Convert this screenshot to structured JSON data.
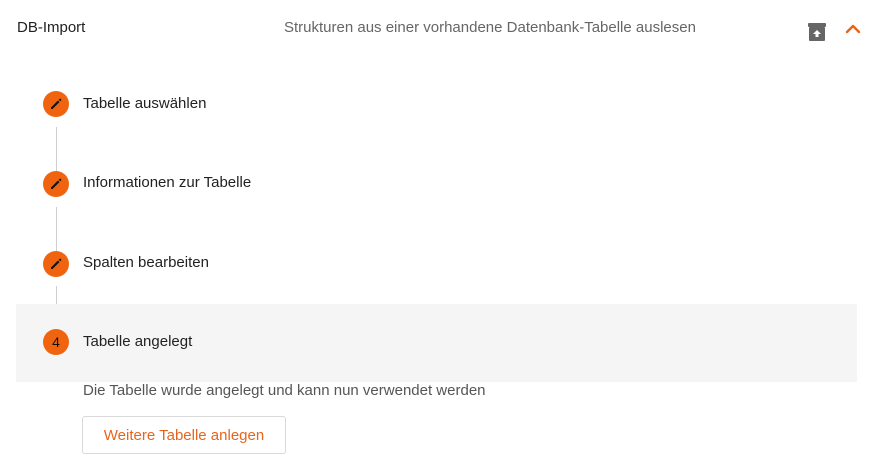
{
  "header": {
    "title": "DB-Import",
    "subtitle": "Strukturen aus einer vorhandene Datenbank-Tabelle auslesen",
    "archive_icon": "archive-upload-icon",
    "collapse_icon": "chevron-up-icon"
  },
  "stepper": {
    "steps": [
      {
        "label": "Tabelle auswählen",
        "state": "completed",
        "icon": "pencil-icon"
      },
      {
        "label": "Informationen zur Tabelle",
        "state": "completed",
        "icon": "pencil-icon"
      },
      {
        "label": "Spalten bearbeiten",
        "state": "completed",
        "icon": "pencil-icon"
      },
      {
        "label": "Tabelle angelegt",
        "state": "active",
        "number": "4"
      }
    ],
    "active_content": {
      "text": "Die Tabelle wurde angelegt und kann nun verwendet werden",
      "button_label": "Weitere Tabelle anlegen"
    }
  },
  "colors": {
    "accent": "#f0640f",
    "button_text": "#e8641b",
    "active_bg": "#f5f5f5",
    "connector": "#cfcfcf"
  }
}
